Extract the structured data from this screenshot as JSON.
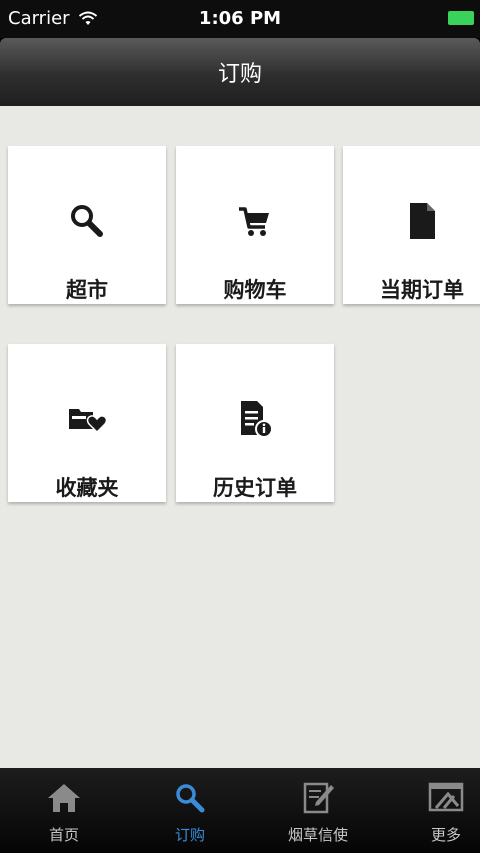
{
  "status_bar": {
    "carrier": "Carrier",
    "time": "1:06 PM"
  },
  "nav": {
    "title": "订购"
  },
  "tiles": [
    {
      "label": "超市",
      "icon": "search-icon"
    },
    {
      "label": "购物车",
      "icon": "cart-icon"
    },
    {
      "label": "当期订单",
      "icon": "document-icon"
    },
    {
      "label": "收藏夹",
      "icon": "folder-heart-icon"
    },
    {
      "label": "历史订单",
      "icon": "document-info-icon"
    }
  ],
  "tabs": [
    {
      "label": "首页",
      "icon": "home-icon",
      "active": false
    },
    {
      "label": "订购",
      "icon": "search-icon",
      "active": true
    },
    {
      "label": "烟草信使",
      "icon": "compose-icon",
      "active": false
    },
    {
      "label": "更多",
      "icon": "more-icon",
      "active": false
    }
  ],
  "colors": {
    "accent": "#3b8bd8",
    "battery": "#3ad25a",
    "background": "#e8e8e4"
  }
}
